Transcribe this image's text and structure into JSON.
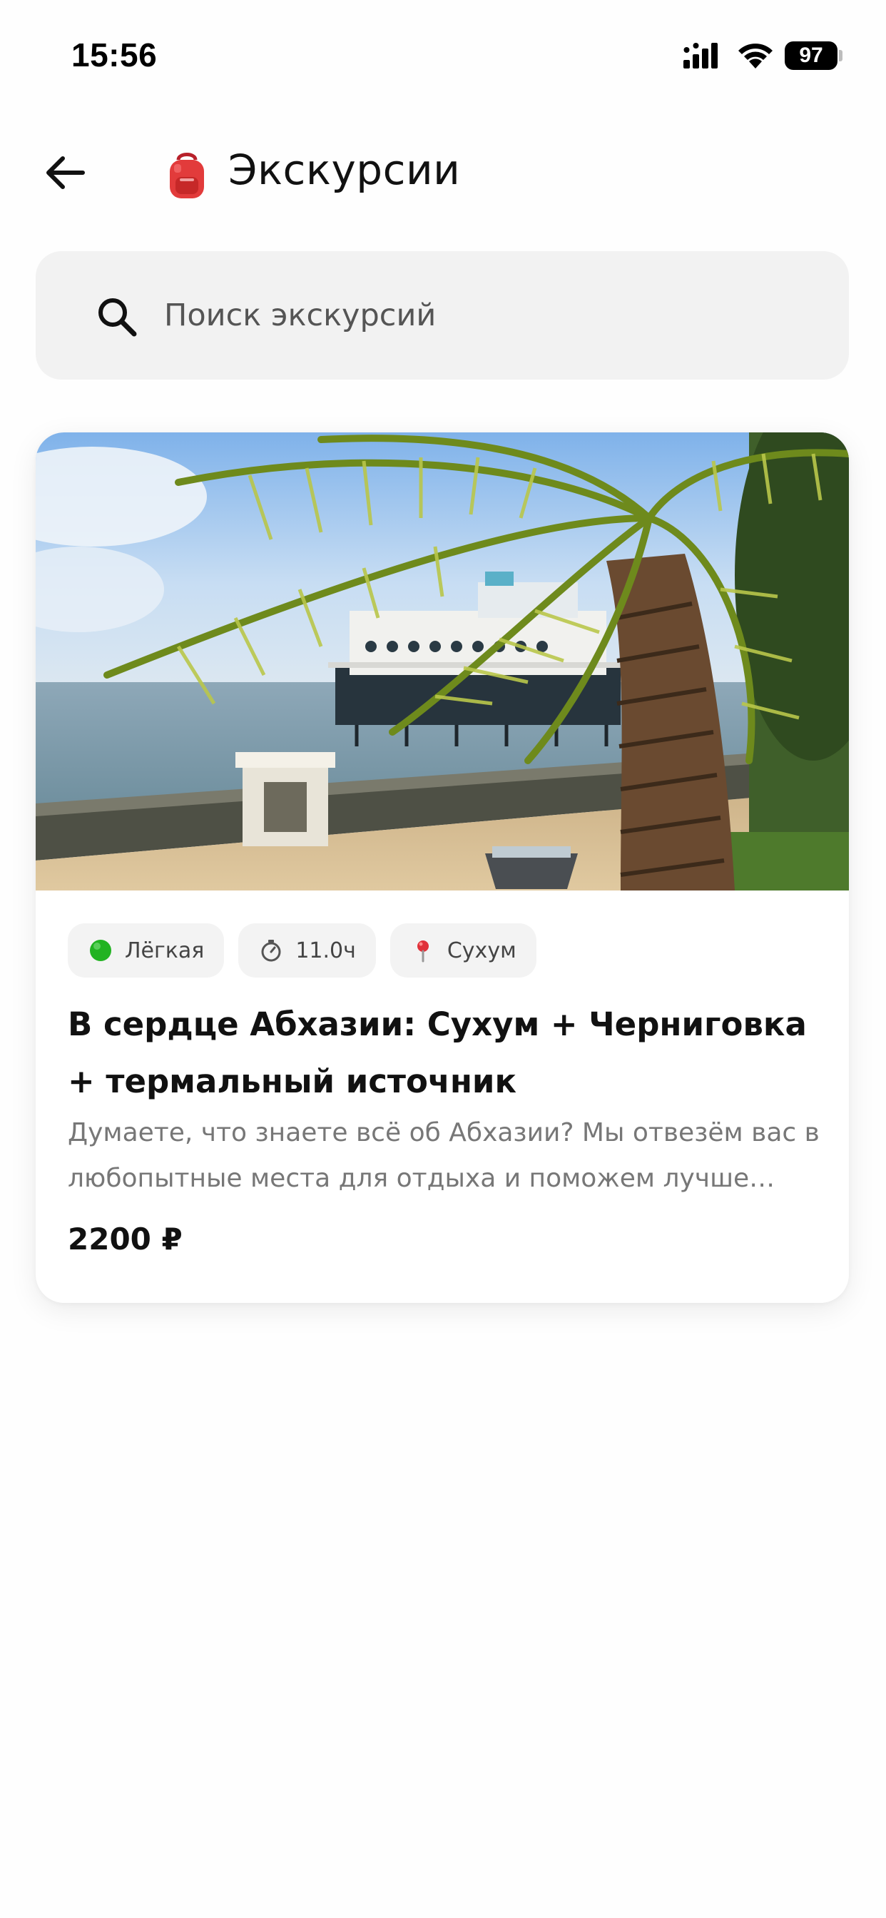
{
  "status_bar": {
    "time": "15:56",
    "battery": "97",
    "icons": [
      "cellular-signal-icon",
      "wifi-icon",
      "battery-icon"
    ]
  },
  "header": {
    "back_icon": "arrow-left-icon",
    "emoji_icon": "backpack-icon",
    "title": "Экскурсии"
  },
  "search": {
    "icon": "search-icon",
    "placeholder": "Поиск экскурсий",
    "value": ""
  },
  "tours": [
    {
      "image": "palm-embankment-photo",
      "tags": [
        {
          "icon": "green-circle-icon",
          "label": "Лёгкая",
          "color": "#22b322"
        },
        {
          "icon": "stopwatch-icon",
          "label": "11.0ч"
        },
        {
          "icon": "map-pin-icon",
          "label": "Сухум",
          "color": "#e0313a"
        }
      ],
      "title": "В сердце Абхазии: Сухум + Черниговка + термальный источник",
      "description": "Думаете, что знаете всё об Абхазии? Мы отвезём вас в любопытные места для отдыха и поможем лучше поня…",
      "price": "2200 ₽"
    }
  ]
}
